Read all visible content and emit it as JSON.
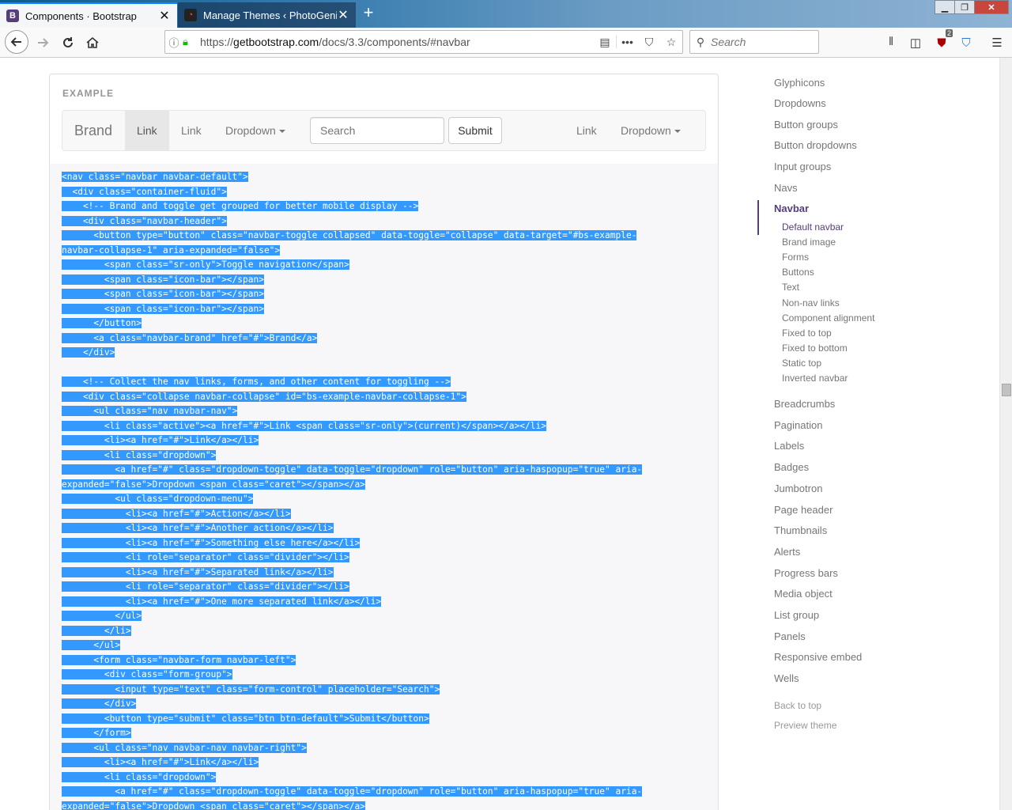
{
  "browser": {
    "tabs": [
      {
        "title": "Components · Bootstrap",
        "favicon": "B"
      },
      {
        "title": "Manage Themes ‹ PhotoGenik",
        "favicon": "PG"
      }
    ],
    "url_prefix": "https://",
    "url_host": "getbootstrap.com",
    "url_path": "/docs/3.3/components/#navbar",
    "search_placeholder": "Search",
    "ublock_badge": "2"
  },
  "example": {
    "label": "EXAMPLE",
    "navbar": {
      "brand": "Brand",
      "link_active": "Link",
      "link2": "Link",
      "dropdown": "Dropdown",
      "search_placeholder": "Search",
      "submit": "Submit",
      "right_link": "Link",
      "right_dropdown": "Dropdown"
    }
  },
  "code_lines": [
    "<nav class=\"navbar navbar-default\">",
    "  <div class=\"container-fluid\">",
    "    <!-- Brand and toggle get grouped for better mobile display -->",
    "    <div class=\"navbar-header\">",
    "      <button type=\"button\" class=\"navbar-toggle collapsed\" data-toggle=\"collapse\" data-target=\"#bs-example-",
    "navbar-collapse-1\" aria-expanded=\"false\">",
    "        <span class=\"sr-only\">Toggle navigation</span>",
    "        <span class=\"icon-bar\"></span>",
    "        <span class=\"icon-bar\"></span>",
    "        <span class=\"icon-bar\"></span>",
    "      </button>",
    "      <a class=\"navbar-brand\" href=\"#\">Brand</a>",
    "    </div>",
    "",
    "    <!-- Collect the nav links, forms, and other content for toggling -->",
    "    <div class=\"collapse navbar-collapse\" id=\"bs-example-navbar-collapse-1\">",
    "      <ul class=\"nav navbar-nav\">",
    "        <li class=\"active\"><a href=\"#\">Link <span class=\"sr-only\">(current)</span></a></li>",
    "        <li><a href=\"#\">Link</a></li>",
    "        <li class=\"dropdown\">",
    "          <a href=\"#\" class=\"dropdown-toggle\" data-toggle=\"dropdown\" role=\"button\" aria-haspopup=\"true\" aria-",
    "expanded=\"false\">Dropdown <span class=\"caret\"></span></a>",
    "          <ul class=\"dropdown-menu\">",
    "            <li><a href=\"#\">Action</a></li>",
    "            <li><a href=\"#\">Another action</a></li>",
    "            <li><a href=\"#\">Something else here</a></li>",
    "            <li role=\"separator\" class=\"divider\"></li>",
    "            <li><a href=\"#\">Separated link</a></li>",
    "            <li role=\"separator\" class=\"divider\"></li>",
    "            <li><a href=\"#\">One more separated link</a></li>",
    "          </ul>",
    "        </li>",
    "      </ul>",
    "      <form class=\"navbar-form navbar-left\">",
    "        <div class=\"form-group\">",
    "          <input type=\"text\" class=\"form-control\" placeholder=\"Search\">",
    "        </div>",
    "        <button type=\"submit\" class=\"btn btn-default\">Submit</button>",
    "      </form>",
    "      <ul class=\"nav navbar-nav navbar-right\">",
    "        <li><a href=\"#\">Link</a></li>",
    "        <li class=\"dropdown\">",
    "          <a href=\"#\" class=\"dropdown-toggle\" data-toggle=\"dropdown\" role=\"button\" aria-haspopup=\"true\" aria-",
    "expanded=\"false\">Dropdown <span class=\"caret\"></span></a>"
  ],
  "sidenav": {
    "items_top": [
      "Glyphicons",
      "Dropdowns",
      "Button groups",
      "Button dropdowns",
      "Input groups",
      "Navs"
    ],
    "active": "Navbar",
    "subitems": [
      "Default navbar",
      "Brand image",
      "Forms",
      "Buttons",
      "Text",
      "Non-nav links",
      "Component alignment",
      "Fixed to top",
      "Fixed to bottom",
      "Static top",
      "Inverted navbar"
    ],
    "items_bottom": [
      "Breadcrumbs",
      "Pagination",
      "Labels",
      "Badges",
      "Jumbotron",
      "Page header",
      "Thumbnails",
      "Alerts",
      "Progress bars",
      "Media object",
      "List group",
      "Panels",
      "Responsive embed",
      "Wells"
    ],
    "back_to_top": "Back to top",
    "preview_theme": "Preview theme"
  }
}
